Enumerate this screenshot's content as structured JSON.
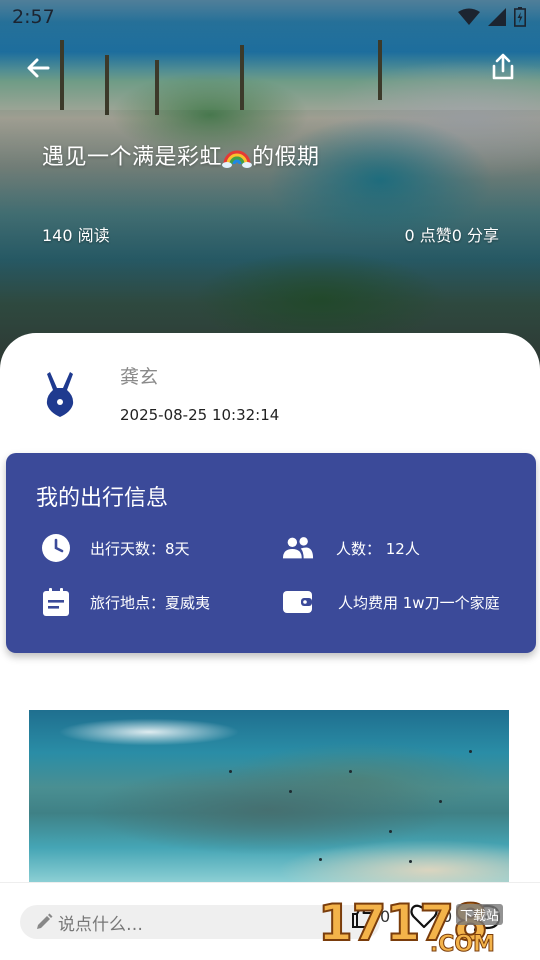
{
  "status_bar": {
    "time": "2:57"
  },
  "post": {
    "title": "遇见一个满是彩虹",
    "title_suffix": "的假期",
    "reads": "140 阅读",
    "likes_shares": "0 点赞0 分享"
  },
  "author": {
    "name": "龚玄",
    "timestamp": "2025-08-25 10:32:14"
  },
  "trip_info": {
    "title": "我的出行信息",
    "days": "出行天数：8天",
    "people": "人数：  12人",
    "location": "旅行地点：夏威夷",
    "cost": "人均费用 1w刀一个家庭"
  },
  "bottom_bar": {
    "comment_placeholder": "说点什么…",
    "like_count": "0",
    "favorite_count": "0"
  },
  "watermark": {
    "number": "17178",
    "suffix": ".COM",
    "tag": "下载站"
  },
  "colors": {
    "card_bg": "#3b4a99",
    "avatar": "#1f3a8f",
    "text_white": "#ffffff"
  }
}
